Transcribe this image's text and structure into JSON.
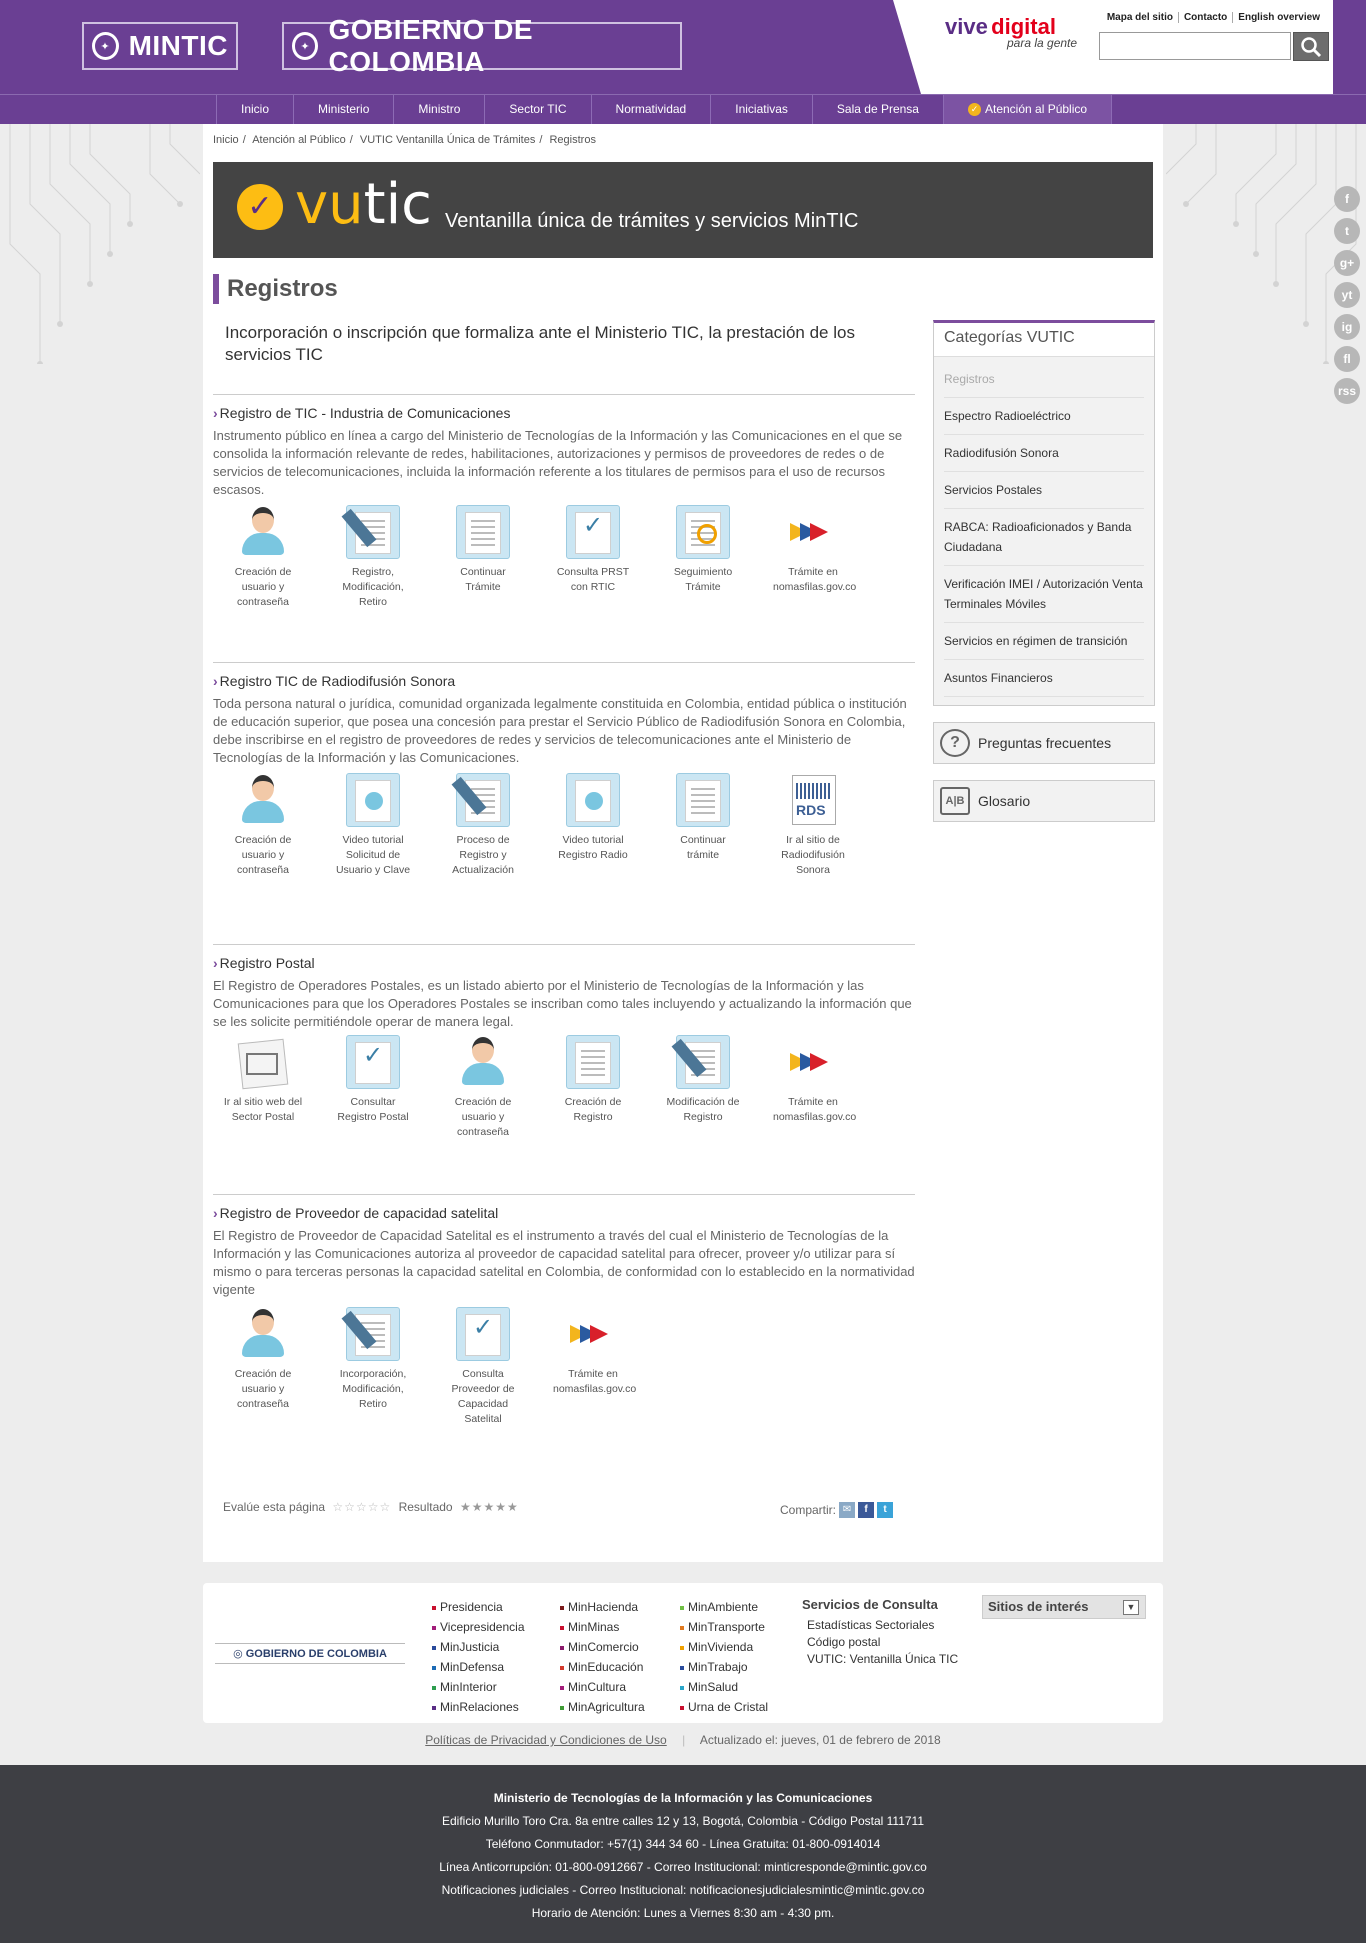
{
  "header": {
    "logo_mintic": "MINTIC",
    "logo_gobierno": "GOBIERNO DE COLOMBIA",
    "vive_part1": "vive",
    "vive_part2": "digital",
    "vive_tagline": "para la gente",
    "top_links": [
      "Mapa del sitio",
      "Contacto",
      "English overview"
    ],
    "search_placeholder": ""
  },
  "nav": {
    "items": [
      "Inicio",
      "Ministerio",
      "Ministro",
      "Sector TIC",
      "Normatividad",
      "Iniciativas",
      "Sala de Prensa",
      "Atención al Público"
    ],
    "active": "Atención al Público"
  },
  "breadcrumb": [
    "Inicio",
    "Atención al Público",
    "VUTIC Ventanilla Única de Trámites",
    "Registros"
  ],
  "banner": {
    "word_part1": "vu",
    "word_part2": "tic",
    "subtitle": "Ventanilla única de trámites y servicios MinTIC"
  },
  "page": {
    "title": "Registros",
    "intro": "Incorporación o inscripción que formaliza ante el Ministerio TIC, la prestación de los servicios TIC"
  },
  "sections": [
    {
      "title": "Registro de TIC - Industria de Comunicaciones",
      "description": "Instrumento público en línea a cargo del Ministerio de Tecnologías de la Información y las Comunicaciones en el que se consolida la información relevante de redes, habilitaciones, autorizaciones y permisos de proveedores de redes o de servicios de telecomunicaciones, incluida la información referente a los titulares de permisos para el uso de recursos escasos.",
      "items": [
        {
          "icon": "user-icon",
          "label": "Creación de usuario y contraseña"
        },
        {
          "icon": "edit-document-icon",
          "label": "Registro, Modificación, Retiro"
        },
        {
          "icon": "clipboard-icon",
          "label": "Continuar Trámite"
        },
        {
          "icon": "check-document-icon",
          "label": "Consulta PRST con RTIC"
        },
        {
          "icon": "search-document-icon",
          "label": "Seguimiento Trámite"
        },
        {
          "icon": "arrows-icon",
          "label": "Trámite en nomasfilas.gov.co"
        }
      ]
    },
    {
      "title": "Registro TIC de Radiodifusión Sonora",
      "description": "Toda persona natural o jurídica, comunidad organizada legalmente constituida en Colombia, entidad pública o institución de educación superior, que posea una concesión para prestar el Servicio Público de Radiodifusión Sonora en Colombia, debe inscribirse en el registro de proveedores de redes y servicios de telecomunicaciones ante el Ministerio de Tecnologías de la Información y las Comunicaciones.",
      "items": [
        {
          "icon": "user-icon",
          "label": "Creación de usuario y contraseña"
        },
        {
          "icon": "video-icon",
          "label": "Video tutorial Solicitud de Usuario y Clave"
        },
        {
          "icon": "edit-document-icon",
          "label": "Proceso de Registro y Actualización"
        },
        {
          "icon": "video-icon",
          "label": "Video tutorial Registro Radio"
        },
        {
          "icon": "clipboard-icon",
          "label": "Continuar trámite"
        },
        {
          "icon": "rds-icon",
          "label": "Ir al sitio de Radiodifusión Sonora"
        }
      ]
    },
    {
      "title": "Registro Postal",
      "description": "El Registro de Operadores Postales, es un listado abierto por el Ministerio de Tecnologías de la Información y las Comunicaciones para que los Operadores Postales se inscriban como tales incluyendo y actualizando la información que se les solicite permitiéndole operar de manera legal.",
      "items": [
        {
          "icon": "envelope-icon",
          "label": "Ir al sitio web del Sector Postal"
        },
        {
          "icon": "check-document-icon",
          "label": "Consultar Registro Postal"
        },
        {
          "icon": "user-icon",
          "label": "Creación de usuario y contraseña"
        },
        {
          "icon": "clipboard-icon",
          "label": "Creación de Registro"
        },
        {
          "icon": "edit-document-icon",
          "label": "Modificación de Registro"
        },
        {
          "icon": "arrows-icon",
          "label": "Trámite en nomasfilas.gov.co"
        }
      ]
    },
    {
      "title": "Registro de Proveedor de capacidad satelital",
      "description": "El Registro de Proveedor de Capacidad Satelital es el instrumento a través del cual el Ministerio de Tecnologías de la Información y las Comunicaciones autoriza al proveedor de capacidad satelital para ofrecer, proveer y/o utilizar para sí mismo o para terceras personas la capacidad satelital en Colombia, de conformidad con lo establecido en la normatividad vigente",
      "items": [
        {
          "icon": "user-icon",
          "label": "Creación de usuario y contraseña"
        },
        {
          "icon": "edit-document-icon",
          "label": "Incorporación, Modificación, Retiro"
        },
        {
          "icon": "check-document-icon",
          "label": "Consulta Proveedor de Capacidad Satelital"
        },
        {
          "icon": "arrows-icon",
          "label": "Trámite en nomasfilas.gov.co"
        }
      ]
    }
  ],
  "rating": {
    "label": "Evalúe esta página",
    "stars": "☆☆☆☆☆",
    "result_label": "Resultado",
    "result_stars": "★★★★★",
    "share_label": "Compartir:"
  },
  "sidebar": {
    "categories_title": "Categorías VUTIC",
    "categories": [
      "Registros",
      "Espectro Radioeléctrico",
      "Radiodifusión Sonora",
      "Servicios Postales",
      "RABCA: Radioaficionados y Banda Ciudadana",
      "Verificación IMEI / Autorización Venta Terminales Móviles",
      "Servicios en régimen de transición",
      "Asuntos Financieros"
    ],
    "faq": "Preguntas frecuentes",
    "glossary": "Glosario"
  },
  "social": [
    "f",
    "t",
    "g+",
    "yt",
    "ig",
    "fl",
    "rss"
  ],
  "footer": {
    "gobierno": "GOBIERNO DE COLOMBIA",
    "col1": [
      {
        "label": "Presidencia",
        "color": "#c8102e"
      },
      {
        "label": "Vicepresidencia",
        "color": "#a21d7a"
      },
      {
        "label": "MinJusticia",
        "color": "#2a4b9b"
      },
      {
        "label": "MinDefensa",
        "color": "#1c6bb5"
      },
      {
        "label": "MinInterior",
        "color": "#2e9e4f"
      },
      {
        "label": "MinRelaciones",
        "color": "#5a2d85"
      }
    ],
    "col2": [
      {
        "label": "MinHacienda",
        "color": "#7b1c1c"
      },
      {
        "label": "MinMinas",
        "color": "#c8102e"
      },
      {
        "label": "MinComercio",
        "color": "#8a1b6b"
      },
      {
        "label": "MinEducación",
        "color": "#d33a2c"
      },
      {
        "label": "MinCultura",
        "color": "#a21d7a"
      },
      {
        "label": "MinAgricultura",
        "color": "#3f9b35"
      }
    ],
    "col3": [
      {
        "label": "MinAmbiente",
        "color": "#6fbf44"
      },
      {
        "label": "MinTransporte",
        "color": "#e07a1f"
      },
      {
        "label": "MinVivienda",
        "color": "#f0a000"
      },
      {
        "label": "MinTrabajo",
        "color": "#2a4b9b"
      },
      {
        "label": "MinSalud",
        "color": "#2aa6c9"
      },
      {
        "label": "Urna de Cristal",
        "color": "#c8102e"
      }
    ],
    "consulta_title": "Servicios de Consulta",
    "consulta_items": [
      "Estadísticas Sectoriales",
      "Código postal",
      "VUTIC: Ventanilla Única TIC"
    ],
    "sitios": "Sitios de interés",
    "policy": "Políticas de Privacidad y Condiciones de Uso",
    "updated": "Actualizado el: jueves, 01 de febrero de 2018",
    "bottom": [
      "Ministerio de Tecnologías de la Información y las Comunicaciones",
      "Edificio Murillo Toro Cra. 8a entre calles 12 y 13, Bogotá, Colombia - Código Postal 111711",
      "Teléfono Conmutador: +57(1) 344 34 60 - Línea Gratuita: 01-800-0914014",
      "Línea Anticorrupción: 01-800-0912667 - Correo Institucional: minticresponde@mintic.gov.co",
      "Notificaciones judiciales - Correo Institucional: notificacionesjudicialesmintic@mintic.gov.co",
      "Horario de Atención: Lunes a Viernes 8:30 am - 4:30 pm."
    ]
  }
}
